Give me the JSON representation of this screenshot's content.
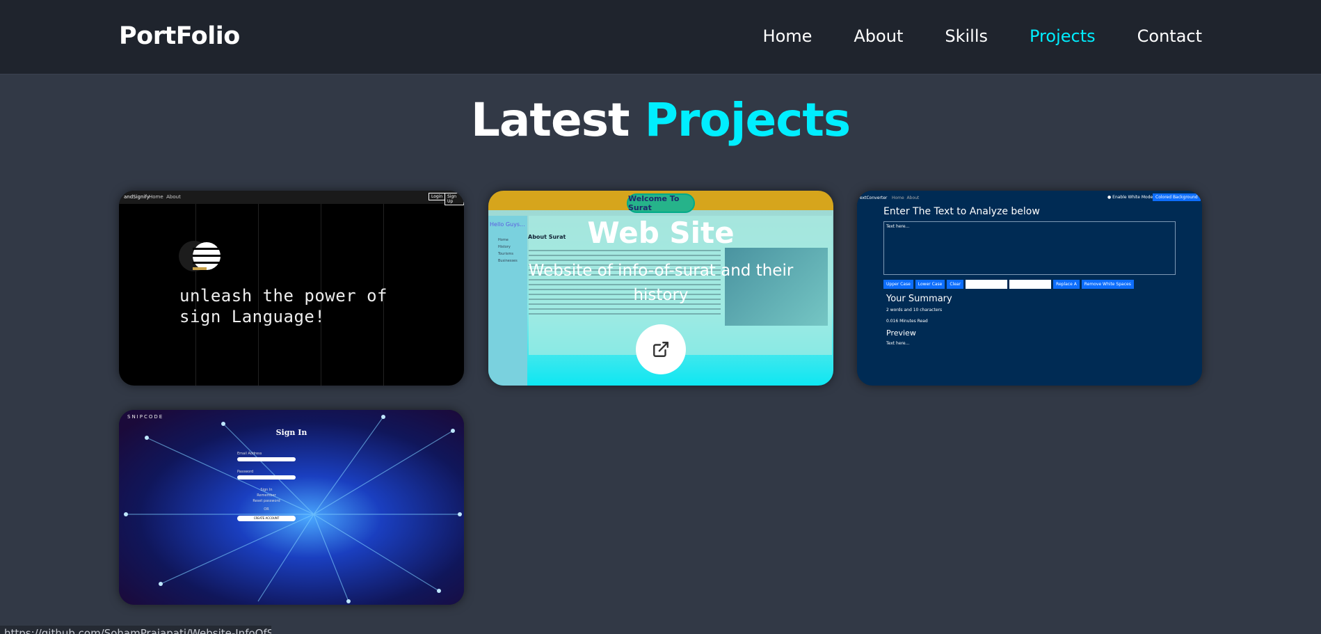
{
  "header": {
    "logo": "PortFolio",
    "nav": [
      "Home",
      "About",
      "Skills",
      "Projects",
      "Contact"
    ],
    "active": "Projects"
  },
  "heading": {
    "prefix": "Latest",
    "accent": "Projects"
  },
  "colors": {
    "accent": "#00eeff",
    "background": "#323946",
    "header": "#1f242d"
  },
  "projects": [
    {
      "preview": {
        "brand": "andSignify",
        "nav": [
          "Home",
          "About"
        ],
        "buttons": [
          "Login",
          "Sign Up"
        ],
        "tagline_1": "unleash the power of",
        "tagline_2": "sign Language!"
      }
    },
    {
      "title": "Web Site",
      "description": "Website of info-of-surat and their history",
      "preview": {
        "banner": "Welcome To Surat",
        "sidebar_label": "Hello Guys...",
        "section": "About Surat",
        "sidebar_links": [
          "Home",
          "History",
          "Tourisms",
          "Businesses"
        ]
      },
      "link_icon": "external-link-icon"
    },
    {
      "preview": {
        "brand": "extConverter",
        "nav": [
          "Home",
          "About"
        ],
        "toggle": "Enable White Mode",
        "bg_button": "Colored Background",
        "heading": "Enter The Text to Analyze below",
        "placeholder": "Text here...",
        "buttons": [
          "Upper Case",
          "Lower Case",
          "Clear",
          "Replace A",
          "Remove White Spaces"
        ],
        "summary": "Your Summary",
        "words": "2 words and 10 characters",
        "minutes": "0.016 Minutes Read",
        "preview_label": "Preview",
        "preview_text": "Text here..."
      }
    },
    {
      "preview": {
        "logo": "SNIPCODE",
        "title": "Sign In",
        "email": "Email Address",
        "password": "Password",
        "signin": "Sign In",
        "remember": "Remember",
        "or": "OR",
        "forgot": "Reset password",
        "create": "CREATE ACCOUNT"
      }
    }
  ],
  "status_url": "https://github.com/SohamPrajapati/Website-InfoOfSurat"
}
